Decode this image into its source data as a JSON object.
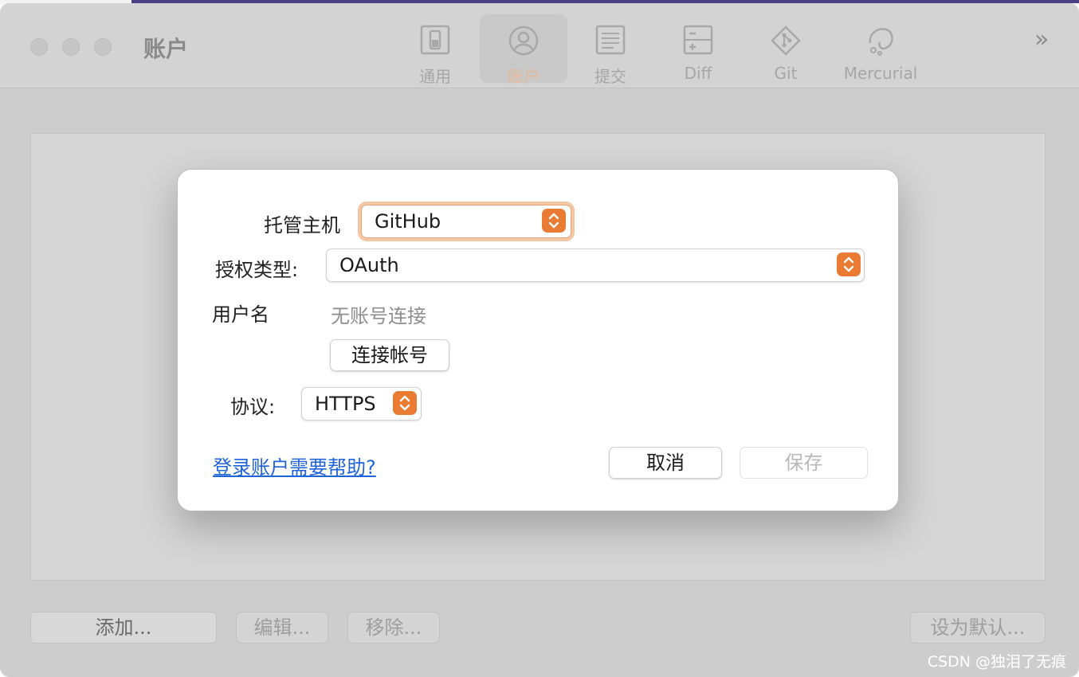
{
  "window": {
    "title": "账户"
  },
  "toolbar": {
    "items": [
      {
        "label": "通用",
        "icon": "general-icon"
      },
      {
        "label": "账户",
        "icon": "account-icon",
        "selected": true
      },
      {
        "label": "提交",
        "icon": "commit-icon"
      },
      {
        "label": "Diff",
        "icon": "diff-icon"
      },
      {
        "label": "Git",
        "icon": "git-icon"
      },
      {
        "label": "Mercurial",
        "icon": "mercurial-icon"
      }
    ],
    "overflow": "»"
  },
  "dialog": {
    "host_label": "托管主机",
    "host_value": "GitHub",
    "auth_label": "授权类型:",
    "auth_value": "OAuth",
    "username_label": "用户名",
    "username_value": "无账号连接",
    "connect_button": "连接帐号",
    "protocol_label": "协议:",
    "protocol_value": "HTTPS",
    "help_link": "登录账户需要帮助?",
    "cancel_button": "取消",
    "save_button": "保存"
  },
  "bottom": {
    "add": "添加...",
    "edit": "编辑...",
    "remove": "移除...",
    "set_default": "设为默认..."
  },
  "watermark": "CSDN @独泪了无痕",
  "colors": {
    "accent": "#e97b32",
    "link": "#1f63d8"
  }
}
